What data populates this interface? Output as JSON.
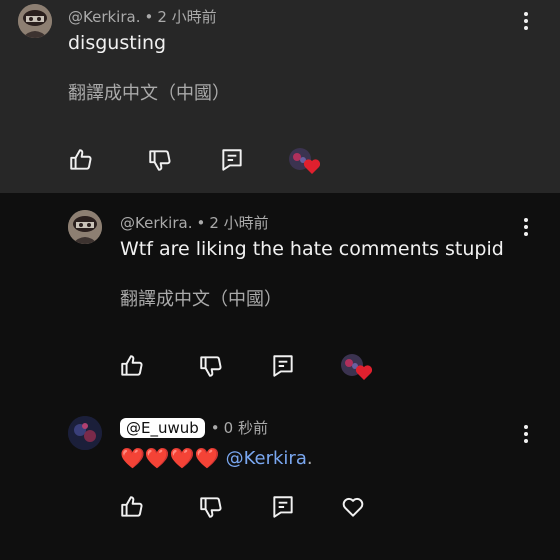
{
  "comments": [
    {
      "author": "@Kerkira.",
      "time": "2 小時前",
      "text": "disgusting",
      "translate": "翻譯成中文（中國）"
    },
    {
      "author": "@Kerkira.",
      "time": "2 小時前",
      "text": "Wtf are liking the hate comments stupid",
      "translate": "翻譯成中文（中國）"
    },
    {
      "author": "@E_uwub",
      "time": "0 秒前",
      "hearts": "❤️❤️❤️❤️",
      "mention": "@Kerkira",
      "mention_suffix": "."
    }
  ],
  "separator": "•",
  "icons": {
    "like": "thumb-up-icon",
    "dislike": "thumb-down-icon",
    "reply": "reply-icon",
    "creator_heart": "creator-heart-icon",
    "heart": "heart-outline-icon",
    "more": "more-vert-icon"
  },
  "colors": {
    "background": "#0f0f0f",
    "highlight": "#272727",
    "meta": "#aaaaaa",
    "link": "#7aa7f0",
    "heart": "#e0202e"
  }
}
